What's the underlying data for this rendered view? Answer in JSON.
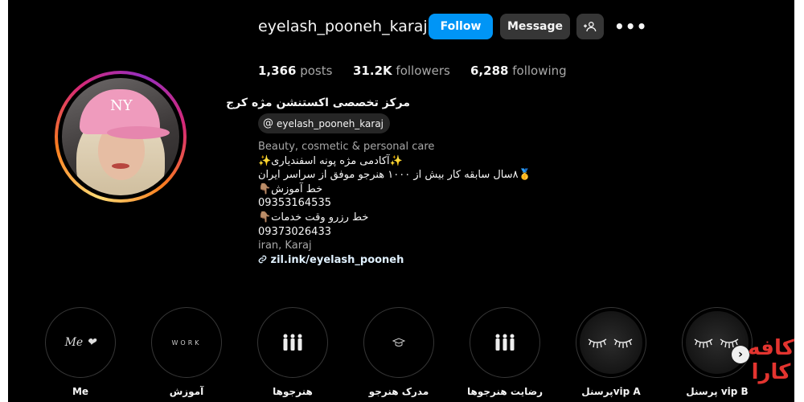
{
  "profile": {
    "username": "eyelash_pooneh_karaj",
    "follow_label": "Follow",
    "message_label": "Message",
    "stats": {
      "posts_count": "1,366",
      "posts_label": "posts",
      "followers_count": "31.2K",
      "followers_label": "followers",
      "following_count": "6,288",
      "following_label": "following"
    },
    "full_name": "مرکز تخصصی اکستنشن مژه کرج",
    "threads_handle": "eyelash_pooneh_karaj",
    "category": "Beauty, cosmetic & personal care",
    "bio_lines": [
      "✨آکادمی مژه پونه اسفندیاری✨",
      "🥇۸سال سابقه کار بیش از ۱۰۰۰ هنرجو موفق از سراسر ایران",
      "خط آموزش👇🏽",
      "09353164535",
      "خط رزرو وقت خدمات👇🏽",
      "09373026433"
    ],
    "location": "iran, Karaj",
    "link": "zil.ink/eyelash_pooneh",
    "avatar_logo": "NY"
  },
  "highlights": [
    {
      "label": "Me",
      "cover_text": "Me ❤"
    },
    {
      "label": "آموزش",
      "cover_text": "WORK"
    },
    {
      "label": "هنرجوها",
      "cover_text": ""
    },
    {
      "label": "مدرک هنرجو",
      "cover_text": ""
    },
    {
      "label": "رضایت هنرجوها",
      "cover_text": ""
    },
    {
      "label": "پرسنلvip A",
      "cover_text": ""
    },
    {
      "label": "پرسنل vip B",
      "cover_text": ""
    }
  ],
  "watermark": {
    "line1": "کافه",
    "line2": "کارا"
  },
  "colors": {
    "follow": "#0095f6",
    "secondary_button": "#363636",
    "background": "#000000",
    "watermark": "#e3342f"
  },
  "icons": [
    "add-person-icon",
    "more-options-icon",
    "threads-icon",
    "link-icon",
    "chevron-right-icon"
  ]
}
